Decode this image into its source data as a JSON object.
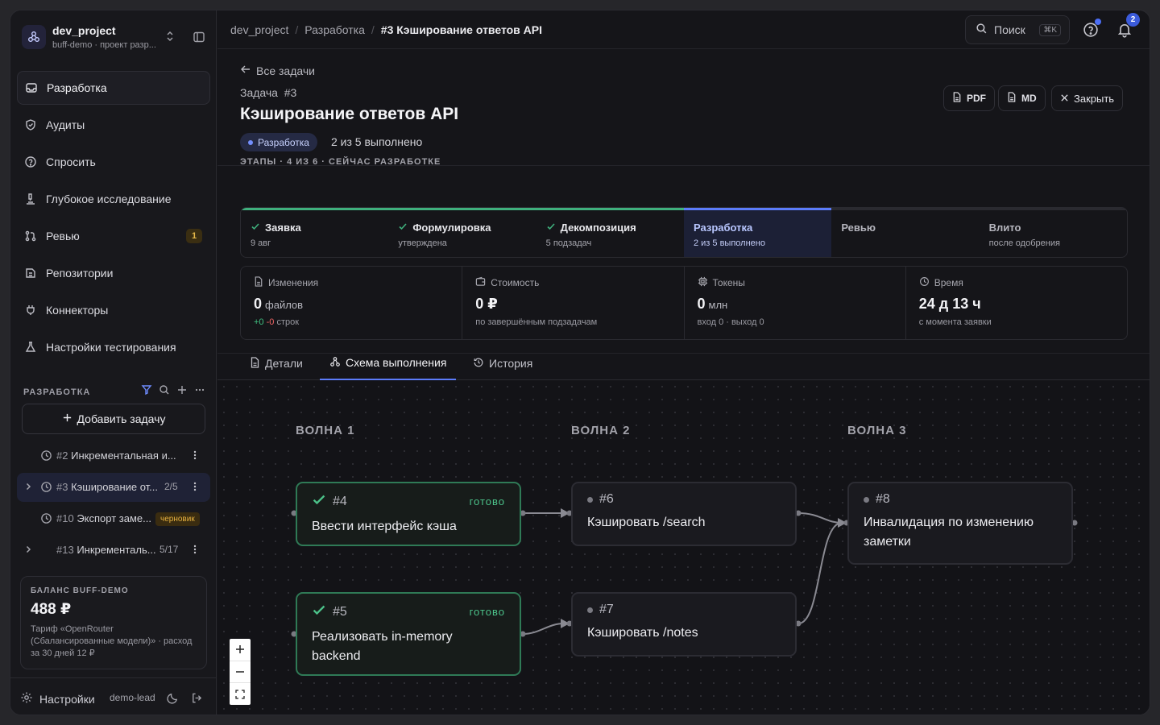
{
  "project": {
    "name": "dev_project",
    "subtitle": "buff-demo · проект разр..."
  },
  "nav": [
    {
      "label": "Разработка"
    },
    {
      "label": "Аудиты"
    },
    {
      "label": "Спросить"
    },
    {
      "label": "Глубокое исследование"
    },
    {
      "label": "Ревью",
      "badge": "1"
    },
    {
      "label": "Репозитории"
    },
    {
      "label": "Коннекторы"
    },
    {
      "label": "Настройки тестирования"
    }
  ],
  "section": {
    "title": "РАЗРАБОТКА",
    "add_task": "Добавить задачу"
  },
  "tasks": [
    {
      "num": "#2",
      "title": "Инкрементальная и..."
    },
    {
      "num": "#3",
      "title": "Кэширование от...",
      "count": "2/5"
    },
    {
      "num": "#10",
      "title": "Экспорт заме...",
      "badge": "черновик"
    },
    {
      "num": "#13",
      "title": "Инкременталь...",
      "count": "5/17"
    }
  ],
  "balance": {
    "title": "БАЛАНС BUFF-DEMO",
    "value": "488 ₽",
    "desc": "Тариф «OpenRouter (Сбалансированные модели)» · расход за 30 дней 12 ₽"
  },
  "footer": {
    "settings": "Настройки",
    "user": "demo-lead"
  },
  "breadcrumbs": [
    "dev_project",
    "Разработка",
    "#3 Кэширование ответов API"
  ],
  "search": {
    "label": "Поиск",
    "shortcut": "⌘K"
  },
  "notifications": {
    "count": "2"
  },
  "header": {
    "back": "Все задачи",
    "task_label": "Задача  #3",
    "title": "Кэширование ответов API",
    "stage_chip": "Разработка",
    "progress": "2 из 5 выполнено",
    "buttons": {
      "pdf": "PDF",
      "md": "MD",
      "close": "Закрыть"
    }
  },
  "stages_label": "ЭТАПЫ · 4 ИЗ 6 · СЕЙЧАС РАЗРАБОТКЕ",
  "stages": [
    {
      "title": "Заявка",
      "sub": "9 авг",
      "state": "done"
    },
    {
      "title": "Формулировка",
      "sub": "утверждена",
      "state": "done"
    },
    {
      "title": "Декомпозиция",
      "sub": "5 подзадач",
      "state": "done"
    },
    {
      "title": "Разработка",
      "sub": "2 из 5 выполнено",
      "state": "current"
    },
    {
      "title": "Ревью",
      "sub": "",
      "state": "future"
    },
    {
      "title": "Влито",
      "sub": "после одобрения",
      "state": "future"
    }
  ],
  "metrics": {
    "changes": {
      "label": "Изменения",
      "value": "0",
      "unit": "файлов",
      "plus": "+0",
      "minus": "-0",
      "tail": "строк"
    },
    "cost": {
      "label": "Стоимость",
      "value": "0 ₽",
      "sub": "по завершённым подзадачам"
    },
    "tokens": {
      "label": "Токены",
      "value": "0",
      "unit": "млн",
      "sub": "вход 0 · выход 0"
    },
    "time": {
      "label": "Время",
      "value": "24 д 13 ч",
      "sub": "с момента заявки"
    }
  },
  "tabs": [
    "Детали",
    "Схема выполнения",
    "История"
  ],
  "waves": [
    "ВОЛНА 1",
    "ВОЛНА 2",
    "ВОЛНА 3"
  ],
  "nodes": [
    {
      "id": "#4",
      "title": "Ввести интерфейс кэша",
      "status": "готово"
    },
    {
      "id": "#5",
      "title": "Реализовать in-memory backend",
      "status": "готово"
    },
    {
      "id": "#6",
      "title": "Кэшировать /search",
      "status": ""
    },
    {
      "id": "#7",
      "title": "Кэшировать /notes",
      "status": ""
    },
    {
      "id": "#8",
      "title": "Инвалидация по изменению заметки",
      "status": ""
    }
  ],
  "colors": {
    "accent": "#5c7cfa",
    "done": "#3fb07d",
    "warning": "#e6b94a"
  }
}
